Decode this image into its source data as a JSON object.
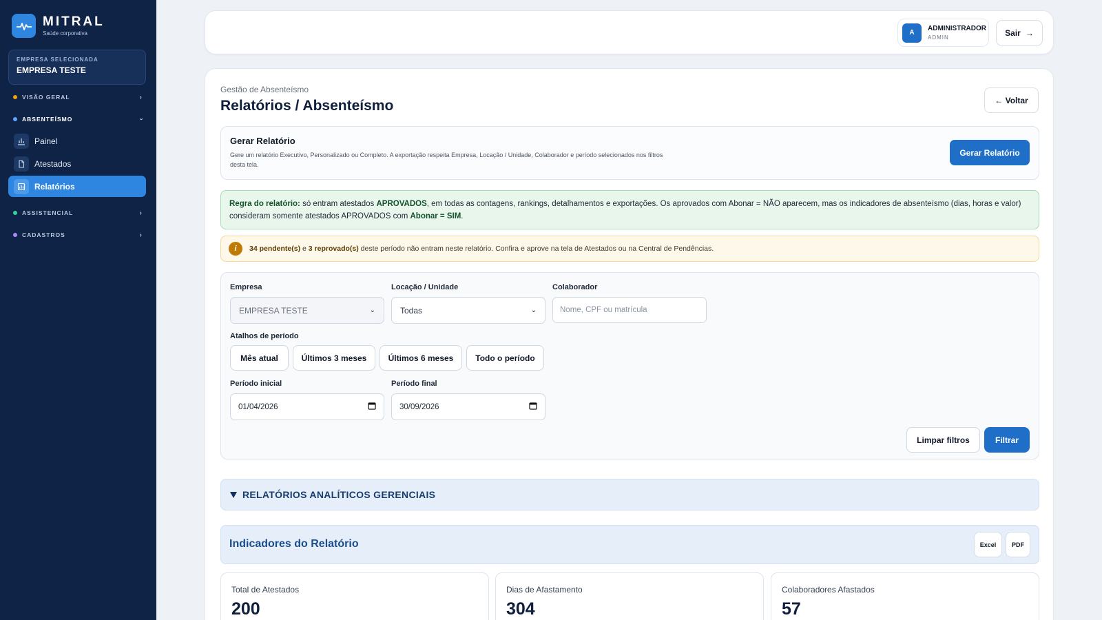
{
  "brand": {
    "name": "MITRAL",
    "subtitle": "Saúde corporativa"
  },
  "sidebar": {
    "company_label": "EMPRESA SELECIONADA",
    "company_name": "EMPRESA TESTE",
    "sections": [
      {
        "label": "VISÃO GERAL",
        "color": "#f59e0b"
      },
      {
        "label": "ABSENTEÍSMO",
        "color": "#60a5fa"
      },
      {
        "label": "ASSISTENCIAL",
        "color": "#34d399"
      },
      {
        "label": "CADASTROS",
        "color": "#a78bfa"
      }
    ],
    "items": [
      {
        "label": "Painel",
        "icon": "bar-chart-icon"
      },
      {
        "label": "Atestados",
        "icon": "document-icon"
      },
      {
        "label": "Relatórios",
        "icon": "report-icon",
        "active": true
      }
    ]
  },
  "topbar": {
    "avatar_letter": "A",
    "user_name": "ADMINISTRADOR",
    "user_role": "ADMIN",
    "logout_label": "Sair",
    "logout_arrow": "→"
  },
  "page": {
    "breadcrumb": "Gestão de Absenteísmo",
    "title": "Relatórios / Absenteísmo",
    "back_label": "← Voltar"
  },
  "generate": {
    "title": "Gerar Relatório",
    "description": "Gere um relatório Executivo, Personalizado ou Completo. A exportação respeita Empresa, Locação / Unidade, Colaborador e período selecionados nos filtros desta tela.",
    "button_label": "Gerar Relatório"
  },
  "rule": {
    "lead": "Regra do relatório:",
    "t1": " só entram atestados ",
    "approved": "APROVADOS",
    "t2": ", em todas as contagens, rankings, detalhamentos e exportações. Os aprovados com Abonar = NÃO aparecem, mas os indicadores de absenteísmo (dias, horas e valor) consideram somente atestados APROVADOS com ",
    "abonar": "Abonar = SIM",
    "t3": "."
  },
  "warning": {
    "icon_letter": "i",
    "pending": "34 pendente(s)",
    "and": " e ",
    "rejected": "3 reprovado(s)",
    "rest": " deste período não entram neste relatório. Confira e aprove na tela de Atestados ou na Central de Pendências."
  },
  "filters": {
    "empresa_label": "Empresa",
    "empresa_value": "EMPRESA TESTE",
    "locacao_label": "Locação / Unidade",
    "locacao_value": "Todas",
    "colaborador_label": "Colaborador",
    "colaborador_placeholder": "Nome, CPF ou matrícula",
    "shortcuts_label": "Atalhos de período",
    "shortcuts": [
      "Mês atual",
      "Últimos 3 meses",
      "Últimos 6 meses",
      "Todo o período"
    ],
    "start_label": "Período inicial",
    "start_value": "01/04/2026",
    "end_label": "Período final",
    "end_value": "30/09/2026",
    "clear_label": "Limpar filtros",
    "filter_label": "Filtrar"
  },
  "accordion": {
    "title": "RELATÓRIOS ANALÍTICOS GERENCIAIS"
  },
  "indicators": {
    "title": "Indicadores do Relatório",
    "excel_label": "Excel",
    "pdf_label": "PDF",
    "kpis": [
      {
        "label": "Total de Atestados",
        "value": "200"
      },
      {
        "label": "Dias de Afastamento",
        "value": "304"
      },
      {
        "label": "Colaboradores Afastados",
        "value": "57"
      }
    ]
  }
}
